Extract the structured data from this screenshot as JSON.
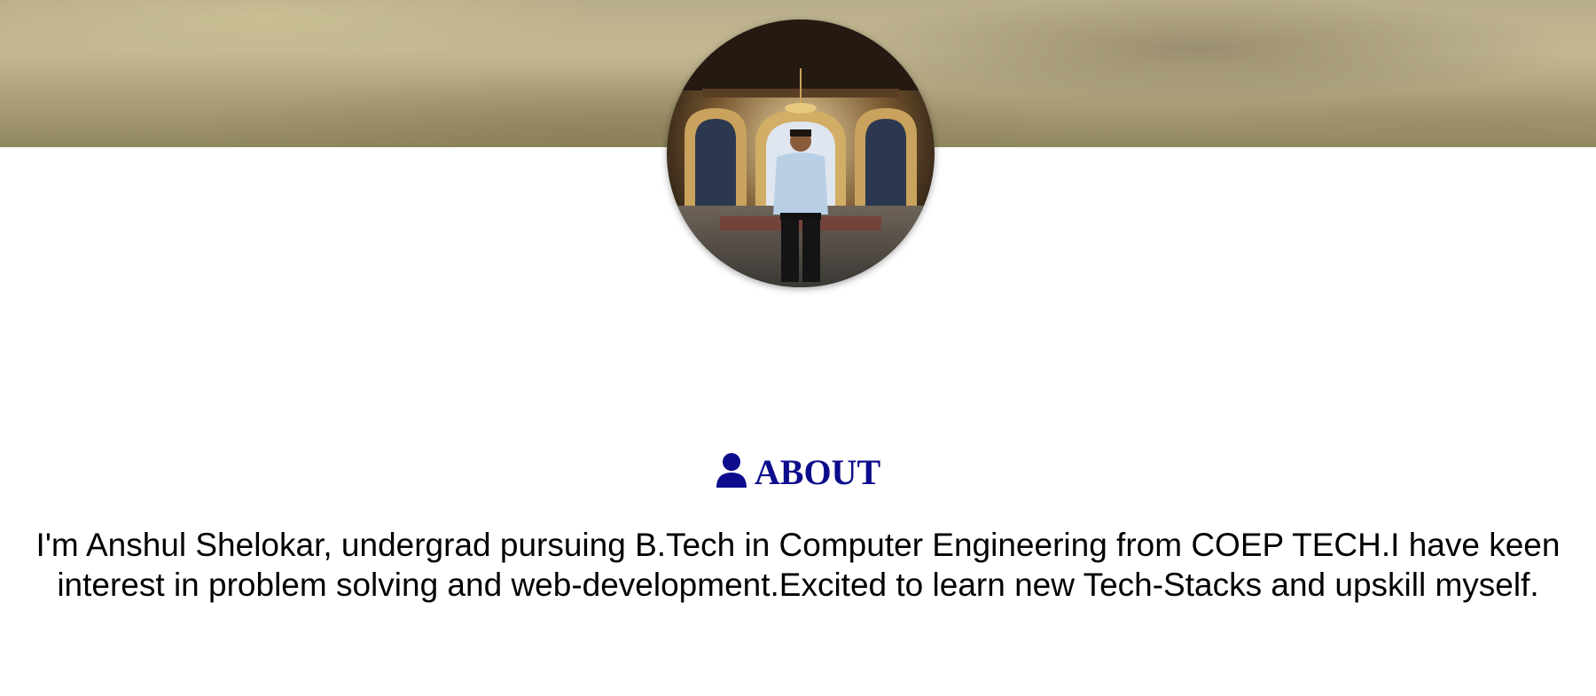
{
  "profile": {
    "banner": "banner-image",
    "photo": "profile-photo"
  },
  "about": {
    "icon": "user-icon",
    "heading": "ABOUT",
    "text": "I'm Anshul Shelokar, undergrad pursuing B.Tech in Computer Engineering from COEP TECH.I have keen interest in problem solving and web-development.Excited to learn new Tech-Stacks and upskill myself.",
    "heading_color": "#0c0c8c"
  }
}
